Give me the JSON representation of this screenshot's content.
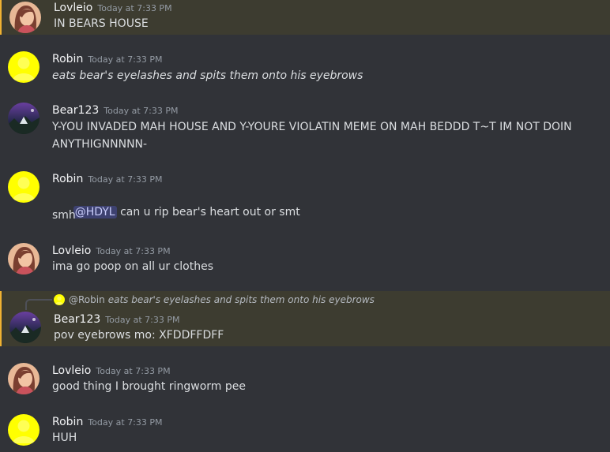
{
  "messages": [
    {
      "author": "Lovleio",
      "timestamp": "Today at 7:33 PM",
      "avatar": "lovleio",
      "lines": [
        "IN BEARS HOUSE"
      ]
    },
    {
      "author": "Robin",
      "timestamp": "Today at 7:33 PM",
      "avatar": "robin",
      "lines": [
        "eats bear's eyelashes and spits them onto his eyebrows"
      ]
    },
    {
      "author": "Bear123",
      "timestamp": "Today at 7:33 PM",
      "avatar": "bear",
      "lines": [
        "Y-YOU INVADED MAH HOUSE AND Y-YOURE VIOLATIN MEME ON MAH BEDDD T~T IM NOT DOIN",
        "ANYTHIGNNNNN-"
      ]
    },
    {
      "author": "Robin",
      "timestamp": "Today at 7:33 PM",
      "avatar": "robin",
      "mention": "@HDYL",
      "lines": [
        "can u rip bear's heart out or smt",
        "smh"
      ]
    },
    {
      "author": "Lovleio",
      "timestamp": "Today at 7:33 PM",
      "avatar": "lovleio",
      "lines": [
        "ima go poop on all ur clothes"
      ]
    },
    {
      "author": "Bear123",
      "timestamp": "Today at 7:33 PM",
      "avatar": "bear",
      "reply": {
        "author": "@Robin",
        "text": "eats bear's eyelashes and spits them onto his eyebrows"
      },
      "lines": [
        "pov eyebrows mo: XFDDFFDFF"
      ]
    },
    {
      "author": "Lovleio",
      "timestamp": "Today at 7:33 PM",
      "avatar": "lovleio",
      "lines": [
        "good thing I brought ringworm pee"
      ]
    },
    {
      "author": "Robin",
      "timestamp": "Today at 7:33 PM",
      "avatar": "robin",
      "lines": [
        "HUH"
      ]
    }
  ],
  "colors": {
    "background": "#313338",
    "highlight": "#3d3c30",
    "highlight_bar": "#f0b232",
    "mention_bg": "#5865f24d",
    "username": "#f2f3f5",
    "timestamp": "#949ba4",
    "text": "#dbdee1"
  }
}
